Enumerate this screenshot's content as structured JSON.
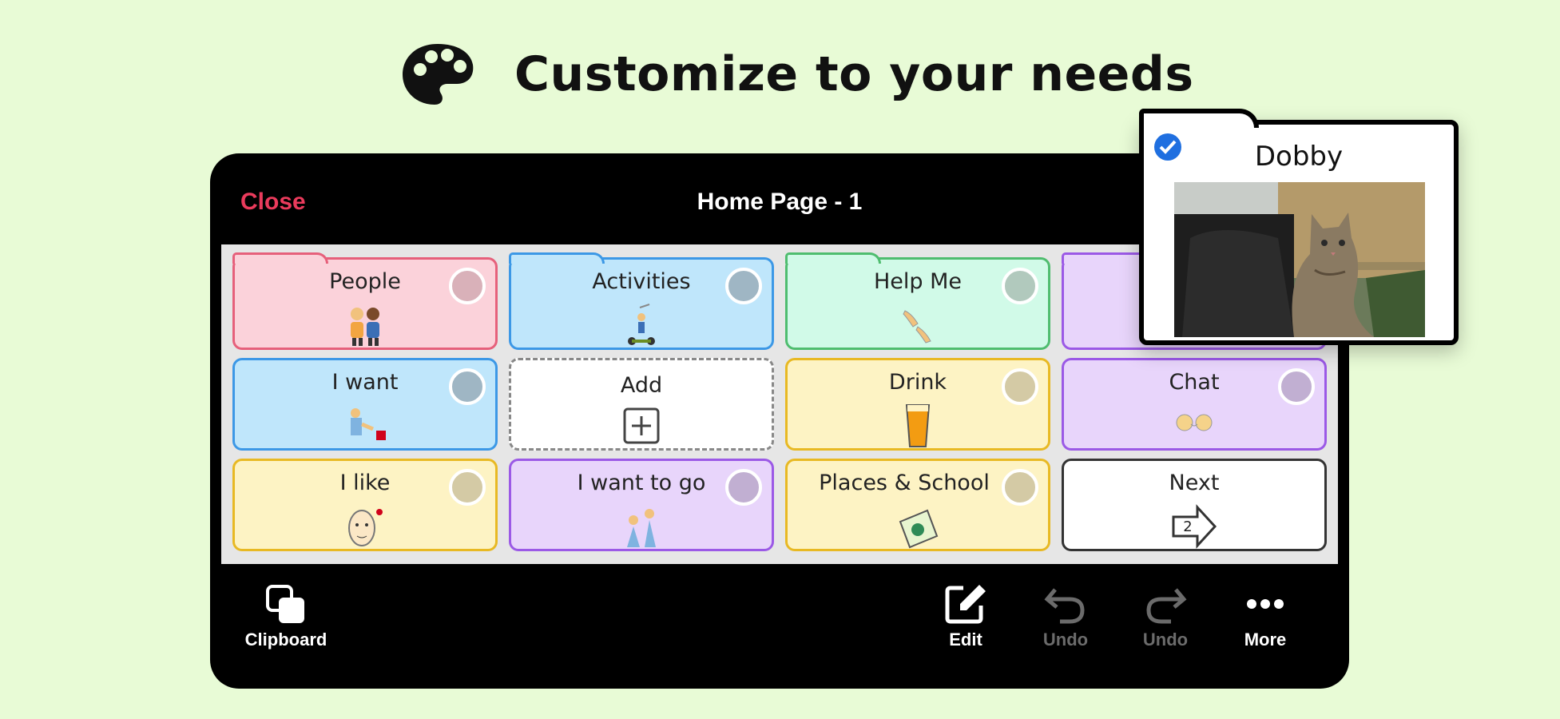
{
  "headline": {
    "text": "Customize to your needs",
    "icon": "palette-icon"
  },
  "screen": {
    "close_label": "Close",
    "title": "Home Page - 1",
    "tiles": {
      "people": "People",
      "activities": "Activities",
      "help_me": "Help Me",
      "i_want": "I want",
      "add": "Add",
      "drink": "Drink",
      "chat": "Chat",
      "i_like": "I like",
      "i_want_to_go": "I want to go",
      "places_school": "Places & School",
      "next": "Next",
      "next_page_number": "2"
    },
    "toolbar": {
      "clipboard": "Clipboard",
      "edit": "Edit",
      "undo": "Undo",
      "redo": "Undo",
      "more": "More"
    }
  },
  "popup": {
    "name": "Dobby",
    "selected": true
  },
  "colors": {
    "background": "#e8fbd6",
    "close": "#ea3b5c",
    "check": "#1f6fe0",
    "pink": "#fbd2da",
    "blue": "#bfe6fb",
    "green": "#d1fae8",
    "purple": "#e8d5fb",
    "yellow": "#fdf3c4"
  }
}
